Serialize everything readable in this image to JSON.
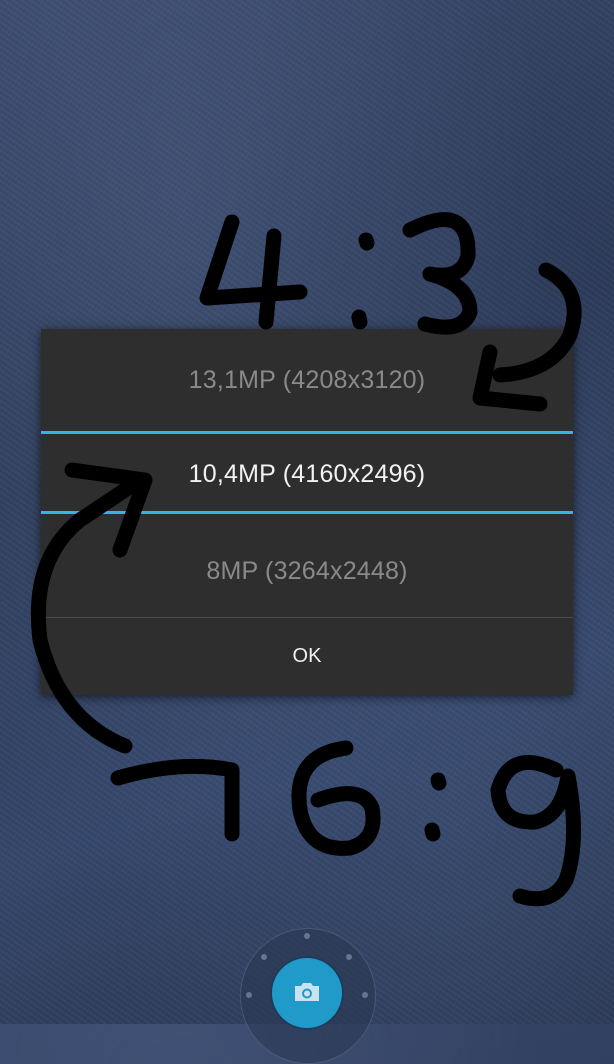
{
  "dialog": {
    "options": [
      {
        "label": "13,1MP (4208x3120)",
        "selected": false
      },
      {
        "label": "10,4MP (4160x2496)",
        "selected": true
      },
      {
        "label": "8MP (3264x2448)",
        "selected": false
      }
    ],
    "ok_label": "OK",
    "accent_color": "#33b5e5"
  },
  "annotations": {
    "top_handwriting": "4:3",
    "bottom_handwriting": "16:9"
  },
  "camera": {
    "shutter_icon": "camera-icon",
    "shutter_color": "#1f9ac9"
  }
}
